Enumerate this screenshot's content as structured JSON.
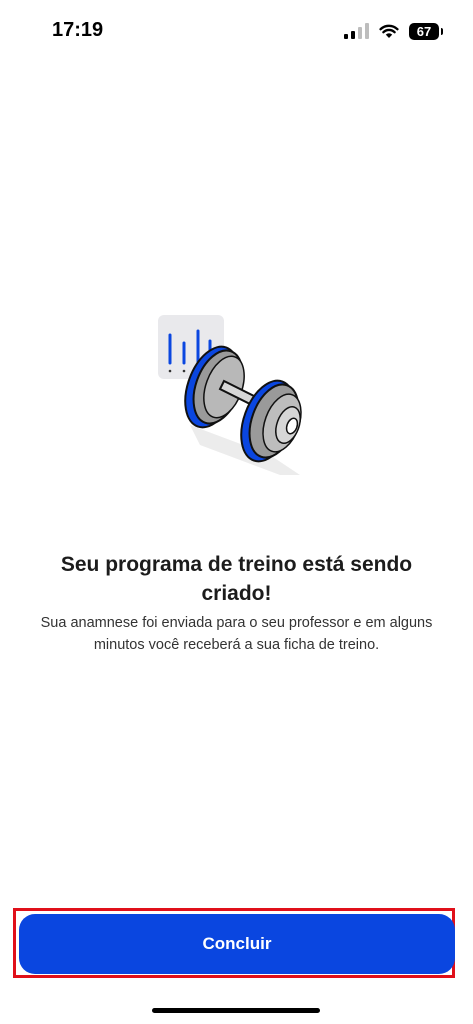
{
  "status_bar": {
    "time": "17:19",
    "battery": "67"
  },
  "illustration": {
    "icon": "dumbbell-icon",
    "card_icon": "bar-chart-icon",
    "accent_color": "#0a46e0"
  },
  "main": {
    "title": "Seu programa de treino está sendo criado!",
    "message": "Sua anamnese foi enviada para o seu professor e em alguns minutos você receberá a sua ficha de treino."
  },
  "footer": {
    "button_label": "Concluir",
    "button_color": "#0a46e0"
  }
}
